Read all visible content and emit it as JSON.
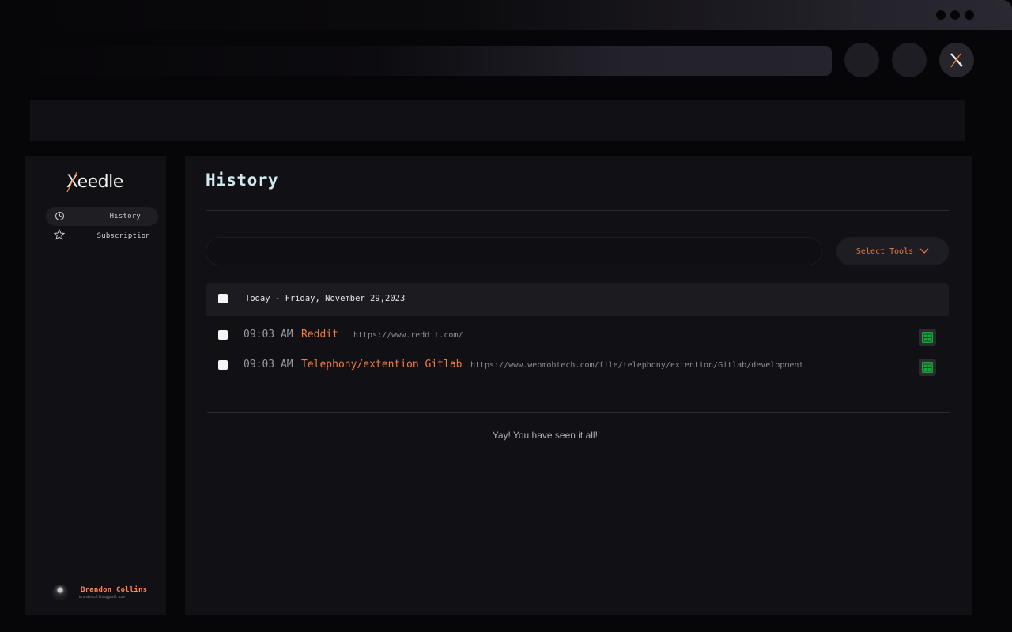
{
  "sidebar": {
    "logo": "Xeedle",
    "items": [
      {
        "label": "History",
        "icon": "clock-icon",
        "active": true
      },
      {
        "label": "Subscription",
        "icon": "star-icon",
        "active": false
      }
    ],
    "user": {
      "name": "Brandon Collins",
      "email": "brandoncollins@gmail.com"
    }
  },
  "main": {
    "title": "History",
    "search": {
      "placeholder": ""
    },
    "select_tools_label": "Select Tools",
    "group": {
      "title": "Today - Friday, November 29,2023",
      "entries": [
        {
          "time": "09:03 AM",
          "title": "Reddit",
          "url": "https://www.reddit.com/",
          "badge_icon": "google-sheets-icon"
        },
        {
          "time": "09:03 AM",
          "title": "Telephony/extention Gitlab",
          "url": "https://www.webmobtech.com/file/telephony/extention/Gitlab/development",
          "badge_icon": "google-sheets-icon"
        }
      ]
    },
    "end_message": "Yay! You have seen it all!!"
  },
  "colors": {
    "accent": "#f07b3f",
    "title": "#cfe9ef",
    "background": "#060508",
    "panel": "#111014",
    "badge_green": "#1aa33a"
  }
}
